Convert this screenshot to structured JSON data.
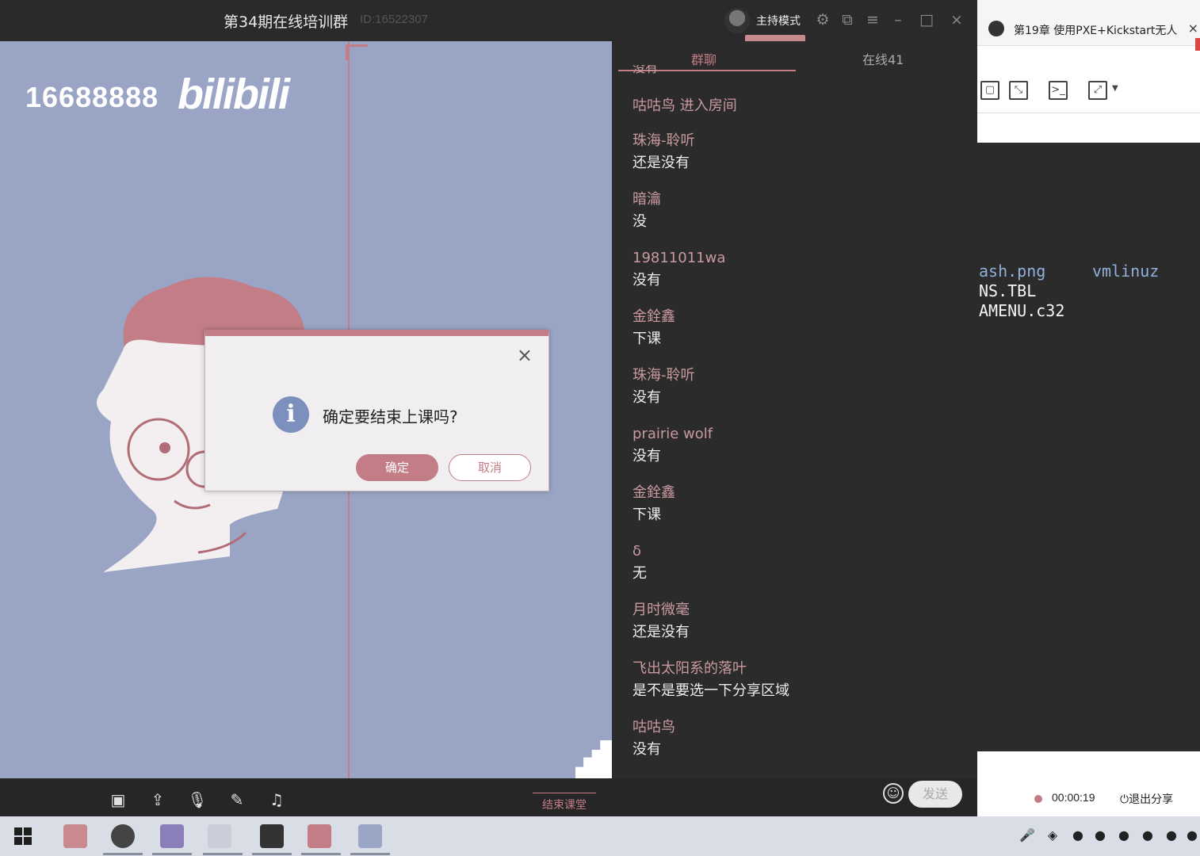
{
  "header": {
    "room_title": "第34期在线培训群",
    "room_id": "ID:16522307",
    "host_mode": "主持模式"
  },
  "share": {
    "logo_number": "16688888",
    "logo_brand": "bilibili"
  },
  "dialog": {
    "message": "确定要结束上课吗?",
    "ok_label": "确定",
    "cancel_label": "取消",
    "close_label": "×",
    "info_glyph": "i"
  },
  "chat": {
    "tab_group": "群聊",
    "tab_online": "在线41",
    "cut_text": "没有",
    "messages": [
      {
        "name": "咕咕鸟 进入房间",
        "text": ""
      },
      {
        "name": "珠海-聆听",
        "text": "还是没有"
      },
      {
        "name": "暗瀹",
        "text": "没"
      },
      {
        "name": "19811011wa",
        "text": "没有"
      },
      {
        "name": "金銓鑫",
        "text": "下课"
      },
      {
        "name": "珠海-聆听",
        "text": "没有"
      },
      {
        "name": "prairie wolf",
        "text": "没有"
      },
      {
        "name": "金銓鑫",
        "text": "下课"
      },
      {
        "name": "δ",
        "text": "无"
      },
      {
        "name": "月时微毫",
        "text": "还是没有"
      },
      {
        "name": "飞出太阳系的落叶",
        "text": "是不是要选一下分享区域"
      },
      {
        "name": "咕咕鸟",
        "text": "没有"
      }
    ],
    "send_label": "发送"
  },
  "toolbar": {
    "end_class_label": "结束课堂"
  },
  "right_window": {
    "tab_title": "第19章 使用PXE+Kickstart无人",
    "terminal": {
      "line1_a": "ash.png",
      "line1_b": "vmlinuz",
      "line2": "NS.TBL",
      "line3": "AMENU.c32"
    },
    "record_time": "00:00:19",
    "exit_share": "退出分享"
  },
  "icons": [
    "settings-icon",
    "popout-icon",
    "menu-icon",
    "minimize-icon",
    "maximize-icon",
    "close-icon",
    "camera-off-icon",
    "share-screen-icon",
    "mic-icon",
    "edit-icon",
    "music-icon",
    "emoji-icon"
  ],
  "colors": {
    "accent": "#c27d86",
    "share_bg": "#9aa5c5",
    "dark_bg": "#2b2b2b"
  }
}
